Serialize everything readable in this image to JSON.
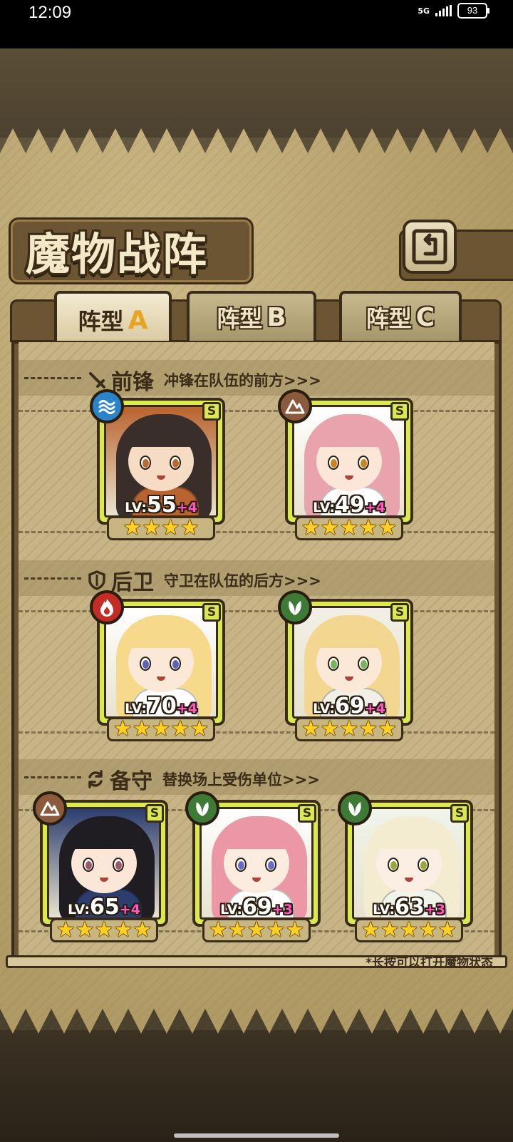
{
  "status_bar": {
    "time": "12:09",
    "network": "5G",
    "battery": "93"
  },
  "header": {
    "title": "魔物战阵"
  },
  "tabs": [
    {
      "label": "阵型",
      "letter": "A",
      "active": true
    },
    {
      "label": "阵型",
      "letter": "B",
      "active": false
    },
    {
      "label": "阵型",
      "letter": "C",
      "active": false
    }
  ],
  "sections": {
    "front": {
      "name": "前锋",
      "desc": "冲锋在队伍的前方>>>"
    },
    "back": {
      "name": "后卫",
      "desc": "守卫在队伍的后方>>>"
    },
    "reserve": {
      "name": "备守",
      "desc": "替换场上受伤单位>>>"
    }
  },
  "units": [
    {
      "row": "front",
      "element": "water",
      "rank": "S",
      "lv_label": "LV:",
      "level": "55",
      "bonus": "+4",
      "stars": 4,
      "hair": "#3a2e2a",
      "skin": "#f6dcc4",
      "outfit": "#b9642e",
      "eye": "#b96a2a"
    },
    {
      "row": "front",
      "element": "earth",
      "rank": "S",
      "lv_label": "LV:",
      "level": "49",
      "bonus": "+4",
      "stars": 5,
      "hair": "#e9a3ad",
      "skin": "#fbe6d8",
      "outfit": "#ffffff",
      "eye": "#c88420"
    },
    {
      "row": "back",
      "element": "fire",
      "rank": "S",
      "lv_label": "LV:",
      "level": "70",
      "bonus": "+4",
      "stars": 5,
      "hair": "#f6d98a",
      "skin": "#fbe8d6",
      "outfit": "#ffffff",
      "eye": "#5b62b8"
    },
    {
      "row": "back",
      "element": "wood",
      "rank": "S",
      "lv_label": "LV:",
      "level": "69",
      "bonus": "+4",
      "stars": 5,
      "hair": "#f3d790",
      "skin": "#fbe8d6",
      "outfit": "#f2efe6",
      "eye": "#76b45a"
    },
    {
      "row": "reserve",
      "element": "earth",
      "rank": "S",
      "lv_label": "LV:",
      "level": "65",
      "bonus": "+4",
      "stars": 5,
      "hair": "#1f1c22",
      "skin": "#fbe6d8",
      "outfit": "#2c3e6e",
      "eye": "#9b5a6a"
    },
    {
      "row": "reserve",
      "element": "wood",
      "rank": "S",
      "lv_label": "LV:",
      "level": "69",
      "bonus": "+3",
      "stars": 5,
      "hair": "#ec97a5",
      "skin": "#fcebdf",
      "outfit": "#ffffff",
      "eye": "#6c6ac8"
    },
    {
      "row": "reserve",
      "element": "wood",
      "rank": "S",
      "lv_label": "LV:",
      "level": "63",
      "bonus": "+3",
      "stars": 5,
      "hair": "#f4ecd0",
      "skin": "#fbeee2",
      "outfit": "#f0f4ea",
      "eye": "#9aa83a"
    }
  ],
  "hint": "*长按可以打开魔物状态",
  "colors": {
    "card_border": "#d9e94e",
    "plus_text": "#ff57c2",
    "star": "#ffcf23",
    "tab_letter_active": "#e7a422"
  }
}
